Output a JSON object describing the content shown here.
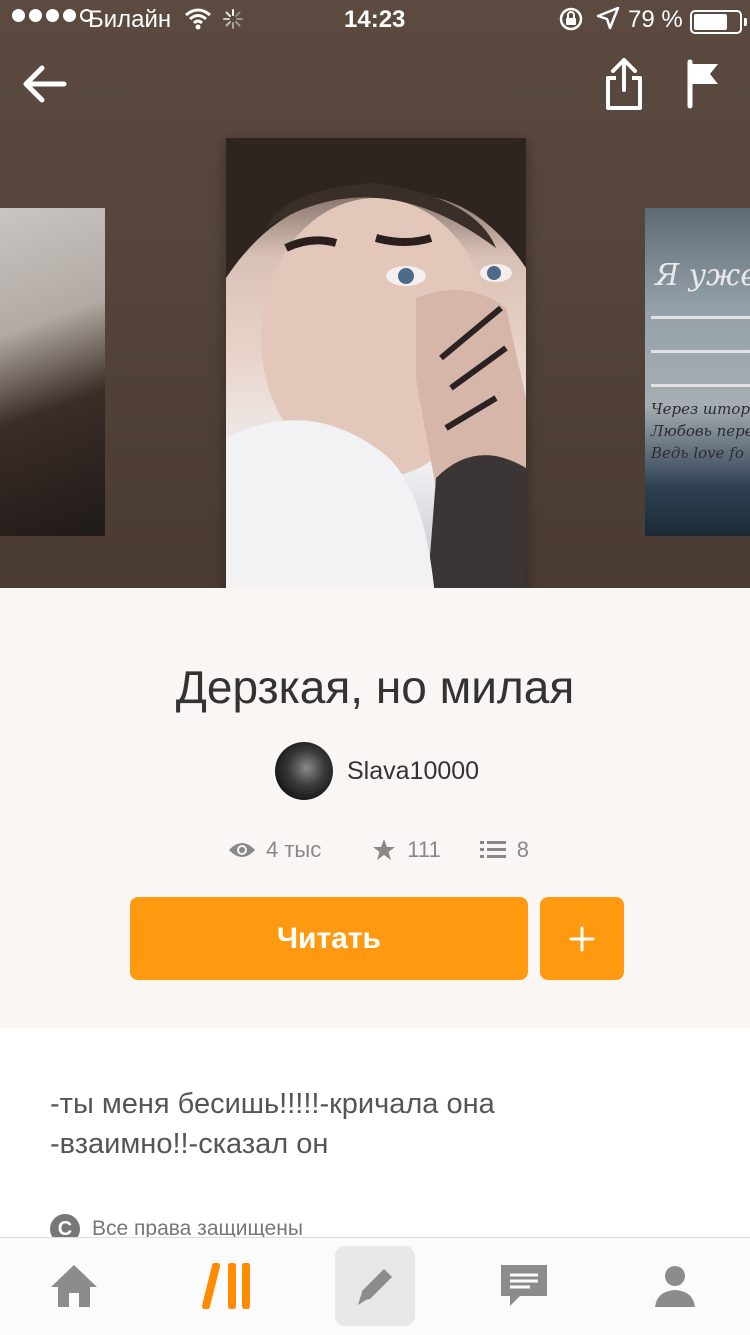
{
  "status_bar": {
    "carrier": "Билайн",
    "time": "14:23",
    "battery_percent": "79 %",
    "battery_level": 0.79
  },
  "story": {
    "title": "Дерзкая, но милая",
    "author": "Slava10000",
    "views": "4 тыс",
    "votes": "111",
    "parts": "8",
    "read_button": "Читать",
    "add_button": "+",
    "description": "-ты меня бесишь!!!!!-кричала она\n-взаимно!!-сказал он",
    "copyright": "Все права защищены"
  },
  "neighbor_cover": {
    "title_text": "Я уже",
    "lines": [
      "Через штор",
      "Любовь пере",
      "Ведь love fo"
    ]
  },
  "tabs": [
    {
      "name": "home",
      "icon": "home-icon",
      "active": false
    },
    {
      "name": "discover",
      "icon": "wattpad-logo-icon",
      "active": true
    },
    {
      "name": "write",
      "icon": "pencil-icon",
      "active": false
    },
    {
      "name": "messages",
      "icon": "chat-icon",
      "active": false
    },
    {
      "name": "profile",
      "icon": "user-icon",
      "active": false
    }
  ],
  "colors": {
    "accent": "#ff9a10",
    "header_bg": "#54443b",
    "page_bg": "#faf6f3"
  }
}
